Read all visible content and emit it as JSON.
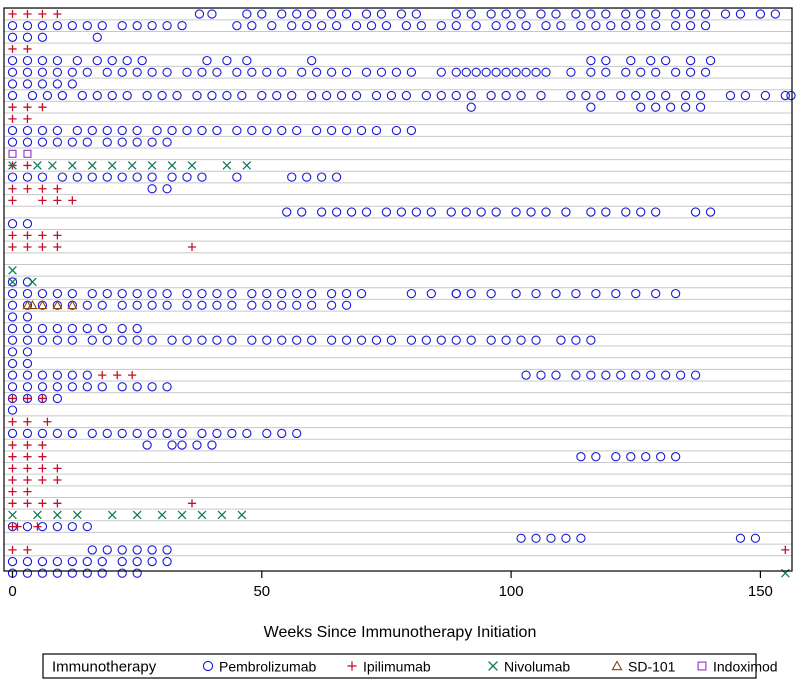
{
  "chart_data": {
    "type": "scatter",
    "title": "",
    "xlabel": "Weeks Since Immunotherapy Initiation",
    "ylabel": "",
    "xlim": [
      -1,
      158
    ],
    "x_ticks": [
      0,
      50,
      100,
      150
    ],
    "x_tick_labels": [
      "0",
      "50",
      "100",
      "150"
    ],
    "n_patients": 47,
    "grid": "horizontal lines between patient rows",
    "legend": {
      "placement": "bottom",
      "title": "Immunotherapy",
      "entries": [
        "Pembrolizumab",
        "Ipilimumab",
        "Nivolumab",
        "SD-101",
        "Indoximod"
      ]
    },
    "series": [
      {
        "name": "Pembrolizumab",
        "marker": "circle",
        "color": "#1a1ad8",
        "rows": [
          [
            37.5,
            40,
            47,
            50,
            54,
            57,
            60,
            64,
            67,
            71,
            74,
            78,
            81,
            89,
            92,
            96,
            99,
            102,
            106,
            109,
            113,
            116,
            119,
            123,
            126,
            129,
            133,
            136,
            139,
            143,
            146,
            150,
            153
          ],
          [
            0,
            3,
            6,
            9,
            12,
            15,
            18,
            22,
            25,
            28,
            31,
            34,
            45,
            48,
            52,
            56,
            59,
            62,
            65,
            69,
            72,
            75,
            79,
            82,
            86,
            89,
            93,
            97,
            100,
            103,
            107,
            110,
            114,
            117,
            120,
            123,
            126,
            129,
            133,
            136,
            139
          ],
          [
            0,
            3,
            6,
            17
          ],
          [],
          [
            0,
            3,
            6,
            9,
            13,
            17,
            20,
            23,
            26,
            39,
            43,
            47,
            60,
            116,
            119,
            124,
            128,
            131,
            136,
            140
          ],
          [
            0,
            3,
            6,
            9,
            12,
            15,
            19,
            22,
            25,
            28,
            31,
            35,
            38,
            41,
            45,
            48,
            51,
            54,
            58,
            61,
            64,
            67,
            71,
            74,
            77,
            80,
            86,
            89,
            91,
            93,
            95,
            97,
            99,
            101,
            103,
            105,
            107,
            112,
            116,
            119,
            123,
            126,
            129,
            133,
            136,
            139
          ],
          [
            0,
            3,
            6,
            9,
            12
          ],
          [
            0,
            4,
            7,
            10,
            14,
            17,
            20,
            23,
            27,
            30,
            33,
            37,
            40,
            43,
            46,
            50,
            53,
            56,
            60,
            63,
            66,
            69,
            73,
            76,
            79,
            83,
            86,
            89,
            92,
            96,
            99,
            102,
            106,
            112,
            115,
            118,
            122,
            125,
            128,
            131,
            135,
            138,
            144,
            147,
            151,
            155,
            158
          ],
          [
            92,
            116,
            126,
            129,
            132,
            135,
            138
          ],
          [],
          [
            0,
            3,
            6,
            9,
            13,
            16,
            19,
            22,
            25,
            29,
            32,
            35,
            38,
            41,
            45,
            48,
            51,
            54,
            57,
            61,
            64,
            67,
            70,
            73,
            77,
            80
          ],
          [
            0,
            3,
            6,
            9,
            12,
            15,
            19,
            22,
            25,
            28,
            31
          ],
          [],
          [],
          [
            0,
            3,
            6,
            10,
            13,
            16,
            19,
            22,
            25,
            28,
            32,
            35,
            38,
            45,
            56,
            59,
            62,
            65
          ],
          [
            28,
            31
          ],
          [],
          [
            55,
            58,
            62,
            65,
            68,
            71,
            75,
            78,
            81,
            84,
            88,
            91,
            94,
            97,
            101,
            104,
            107,
            111,
            116,
            119,
            123,
            126,
            129,
            137,
            140
          ],
          [
            0,
            3
          ],
          [],
          [],
          [],
          [],
          [
            0,
            3
          ],
          [
            0,
            3,
            6,
            9,
            12,
            16,
            19,
            22,
            25,
            28,
            31,
            35,
            38,
            41,
            44,
            48,
            51,
            54,
            57,
            60,
            64,
            67,
            70,
            80,
            84,
            89,
            89,
            92,
            96,
            101,
            105,
            109,
            113,
            117,
            121,
            125,
            129,
            133
          ],
          [
            0,
            3,
            6,
            9,
            12,
            15,
            18,
            22,
            25,
            28,
            31,
            35,
            38,
            41,
            44,
            48,
            51,
            54,
            57,
            60,
            64,
            67
          ],
          [
            0,
            3
          ],
          [
            0,
            3,
            6,
            9,
            12,
            15,
            18,
            22,
            25
          ],
          [
            0,
            3,
            6,
            9,
            12,
            16,
            19,
            22,
            25,
            28,
            32,
            35,
            38,
            41,
            44,
            48,
            51,
            54,
            57,
            60,
            64,
            67,
            70,
            73,
            76,
            80,
            83,
            86,
            89,
            92,
            96,
            99,
            102,
            105,
            110,
            113,
            116
          ],
          [
            0,
            3
          ],
          [
            0,
            3
          ],
          [
            0,
            3,
            6,
            9,
            12,
            15,
            103,
            106,
            109,
            113,
            116,
            119,
            122,
            125,
            128,
            131,
            134,
            137
          ],
          [
            0,
            3,
            6,
            9,
            12,
            15,
            18,
            22,
            25,
            28,
            31
          ],
          [
            0,
            3,
            6,
            9
          ],
          [
            0
          ],
          [],
          [
            0,
            3,
            6,
            9,
            12,
            16,
            19,
            22,
            25,
            28,
            31,
            34,
            38,
            41,
            44,
            47,
            51,
            54,
            57
          ],
          [
            27,
            32,
            34,
            37,
            40
          ],
          [
            114,
            117,
            121,
            124,
            127,
            130,
            133
          ],
          [],
          [],
          [],
          [],
          [],
          [
            0,
            3,
            6,
            9,
            12,
            15
          ],
          [
            102,
            105,
            108,
            111,
            114,
            146,
            149
          ],
          [
            16,
            19,
            22,
            25,
            28,
            31
          ],
          [
            0,
            3,
            6,
            9,
            12,
            15,
            18,
            22,
            25,
            28,
            31
          ],
          [
            0,
            3,
            6,
            9,
            12,
            15,
            18,
            22,
            25
          ]
        ]
      },
      {
        "name": "Ipilimumab",
        "marker": "plus",
        "color": "#c8102e",
        "rows": [
          [
            0,
            3,
            6,
            9
          ],
          [],
          [],
          [
            0,
            3
          ],
          [],
          [],
          [],
          [],
          [
            0,
            3,
            6
          ],
          [
            0,
            3
          ],
          [],
          [],
          [],
          [
            0,
            3
          ],
          [],
          [
            0,
            3,
            6,
            9
          ],
          [
            0,
            6,
            9,
            12
          ],
          [],
          [],
          [
            0,
            3,
            6,
            9
          ],
          [
            0,
            3,
            6,
            9,
            36
          ],
          [],
          [],
          [],
          [],
          [],
          [],
          [],
          [],
          [],
          [],
          [
            18,
            21,
            24
          ],
          [],
          [
            0,
            3,
            6
          ],
          [],
          [
            0,
            3,
            7
          ],
          [],
          [
            0,
            3,
            6
          ],
          [
            0,
            3,
            6
          ],
          [
            0,
            3,
            6,
            9
          ],
          [
            0,
            3,
            6,
            9
          ],
          [
            0,
            3
          ],
          [
            0,
            3,
            6,
            9,
            36
          ],
          [],
          [
            0,
            1,
            5
          ],
          [],
          [
            0,
            3,
            155
          ]
        ]
      },
      {
        "name": "Nivolumab",
        "marker": "x",
        "color": "#0f7a5a",
        "rows": [
          [],
          [],
          [],
          [],
          [],
          [],
          [],
          [],
          [],
          [],
          [],
          [],
          [],
          [
            0,
            5,
            8,
            12,
            16,
            20,
            24,
            28,
            32,
            36,
            43,
            47
          ],
          [],
          [],
          [],
          [],
          [],
          [],
          [],
          [],
          [
            0
          ],
          [
            0,
            4
          ],
          [],
          [],
          [],
          [],
          [],
          [],
          [],
          [],
          [],
          [],
          [],
          [],
          [],
          [],
          [],
          [],
          [],
          [],
          [],
          [
            0,
            5,
            9,
            13,
            20,
            25,
            30,
            34,
            38,
            42,
            46
          ],
          [],
          [],
          [],
          [],
          [
            155
          ]
        ]
      },
      {
        "name": "SD-101",
        "marker": "triangle",
        "color": "#8b4513",
        "rows": [
          [],
          [],
          [],
          [],
          [],
          [],
          [],
          [],
          [],
          [],
          [],
          [],
          [],
          [],
          [],
          [],
          [],
          [],
          [],
          [],
          [],
          [],
          [],
          [],
          [],
          [
            3,
            4,
            6,
            9,
            12
          ]
        ]
      },
      {
        "name": "Indoximod",
        "marker": "square",
        "color": "#9b30c0",
        "rows": [
          [],
          [],
          [],
          [],
          [],
          [],
          [],
          [],
          [],
          [],
          [],
          [],
          [
            0,
            3
          ]
        ]
      }
    ]
  }
}
